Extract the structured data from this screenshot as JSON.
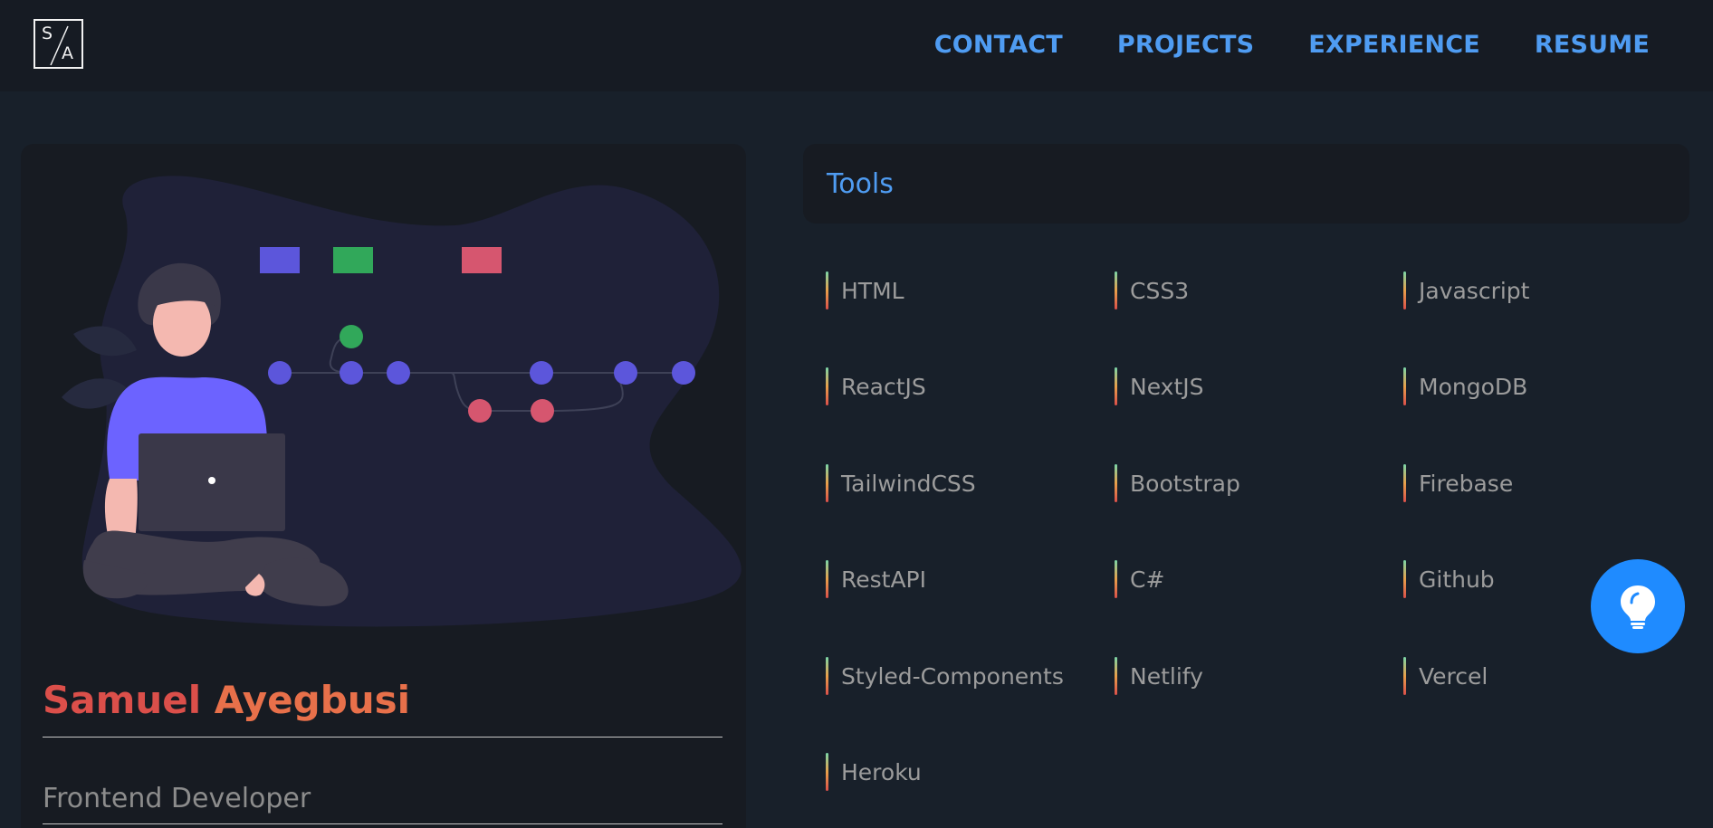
{
  "nav": {
    "logo_top": "S",
    "logo_bottom": "A",
    "links": [
      "CONTACT",
      "PROJECTS",
      "EXPERIENCE",
      "RESUME"
    ],
    "accent_color": "#4f9cf2"
  },
  "profile": {
    "first_name": "Samuel",
    "last_name": "Ayegbusi",
    "role": "Frontend Developer",
    "illustration": "person-with-laptop-git-branches-illustration"
  },
  "tools": {
    "title": "Tools",
    "items": [
      "HTML",
      "CSS3",
      "Javascript",
      "ReactJS",
      "NextJS",
      "MongoDB",
      "TailwindCSS",
      "Bootstrap",
      "Firebase",
      "RestAPI",
      "C#",
      "Github",
      "Styled-Components",
      "Netlify",
      "Vercel",
      "Heroku"
    ]
  },
  "fab": {
    "icon": "lightbulb-icon",
    "color": "#1f8bff"
  }
}
